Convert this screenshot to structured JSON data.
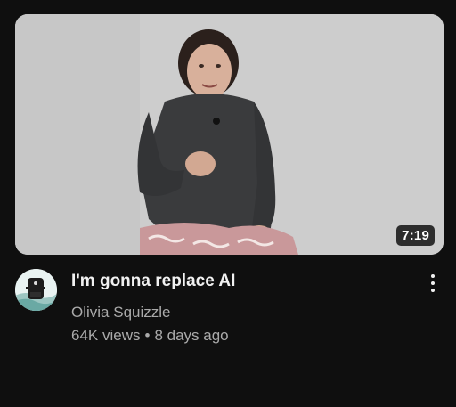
{
  "video": {
    "title": "I'm gonna replace AI",
    "duration": "7:19",
    "channel": "Olivia Squizzle",
    "views": "64K views",
    "separator": "•",
    "age": "8 days ago"
  },
  "icons": {
    "menu": "more-vert-icon"
  },
  "colors": {
    "background": "#0f0f0f",
    "title": "#f1f1f1",
    "secondary_text": "#aaaaaa"
  }
}
